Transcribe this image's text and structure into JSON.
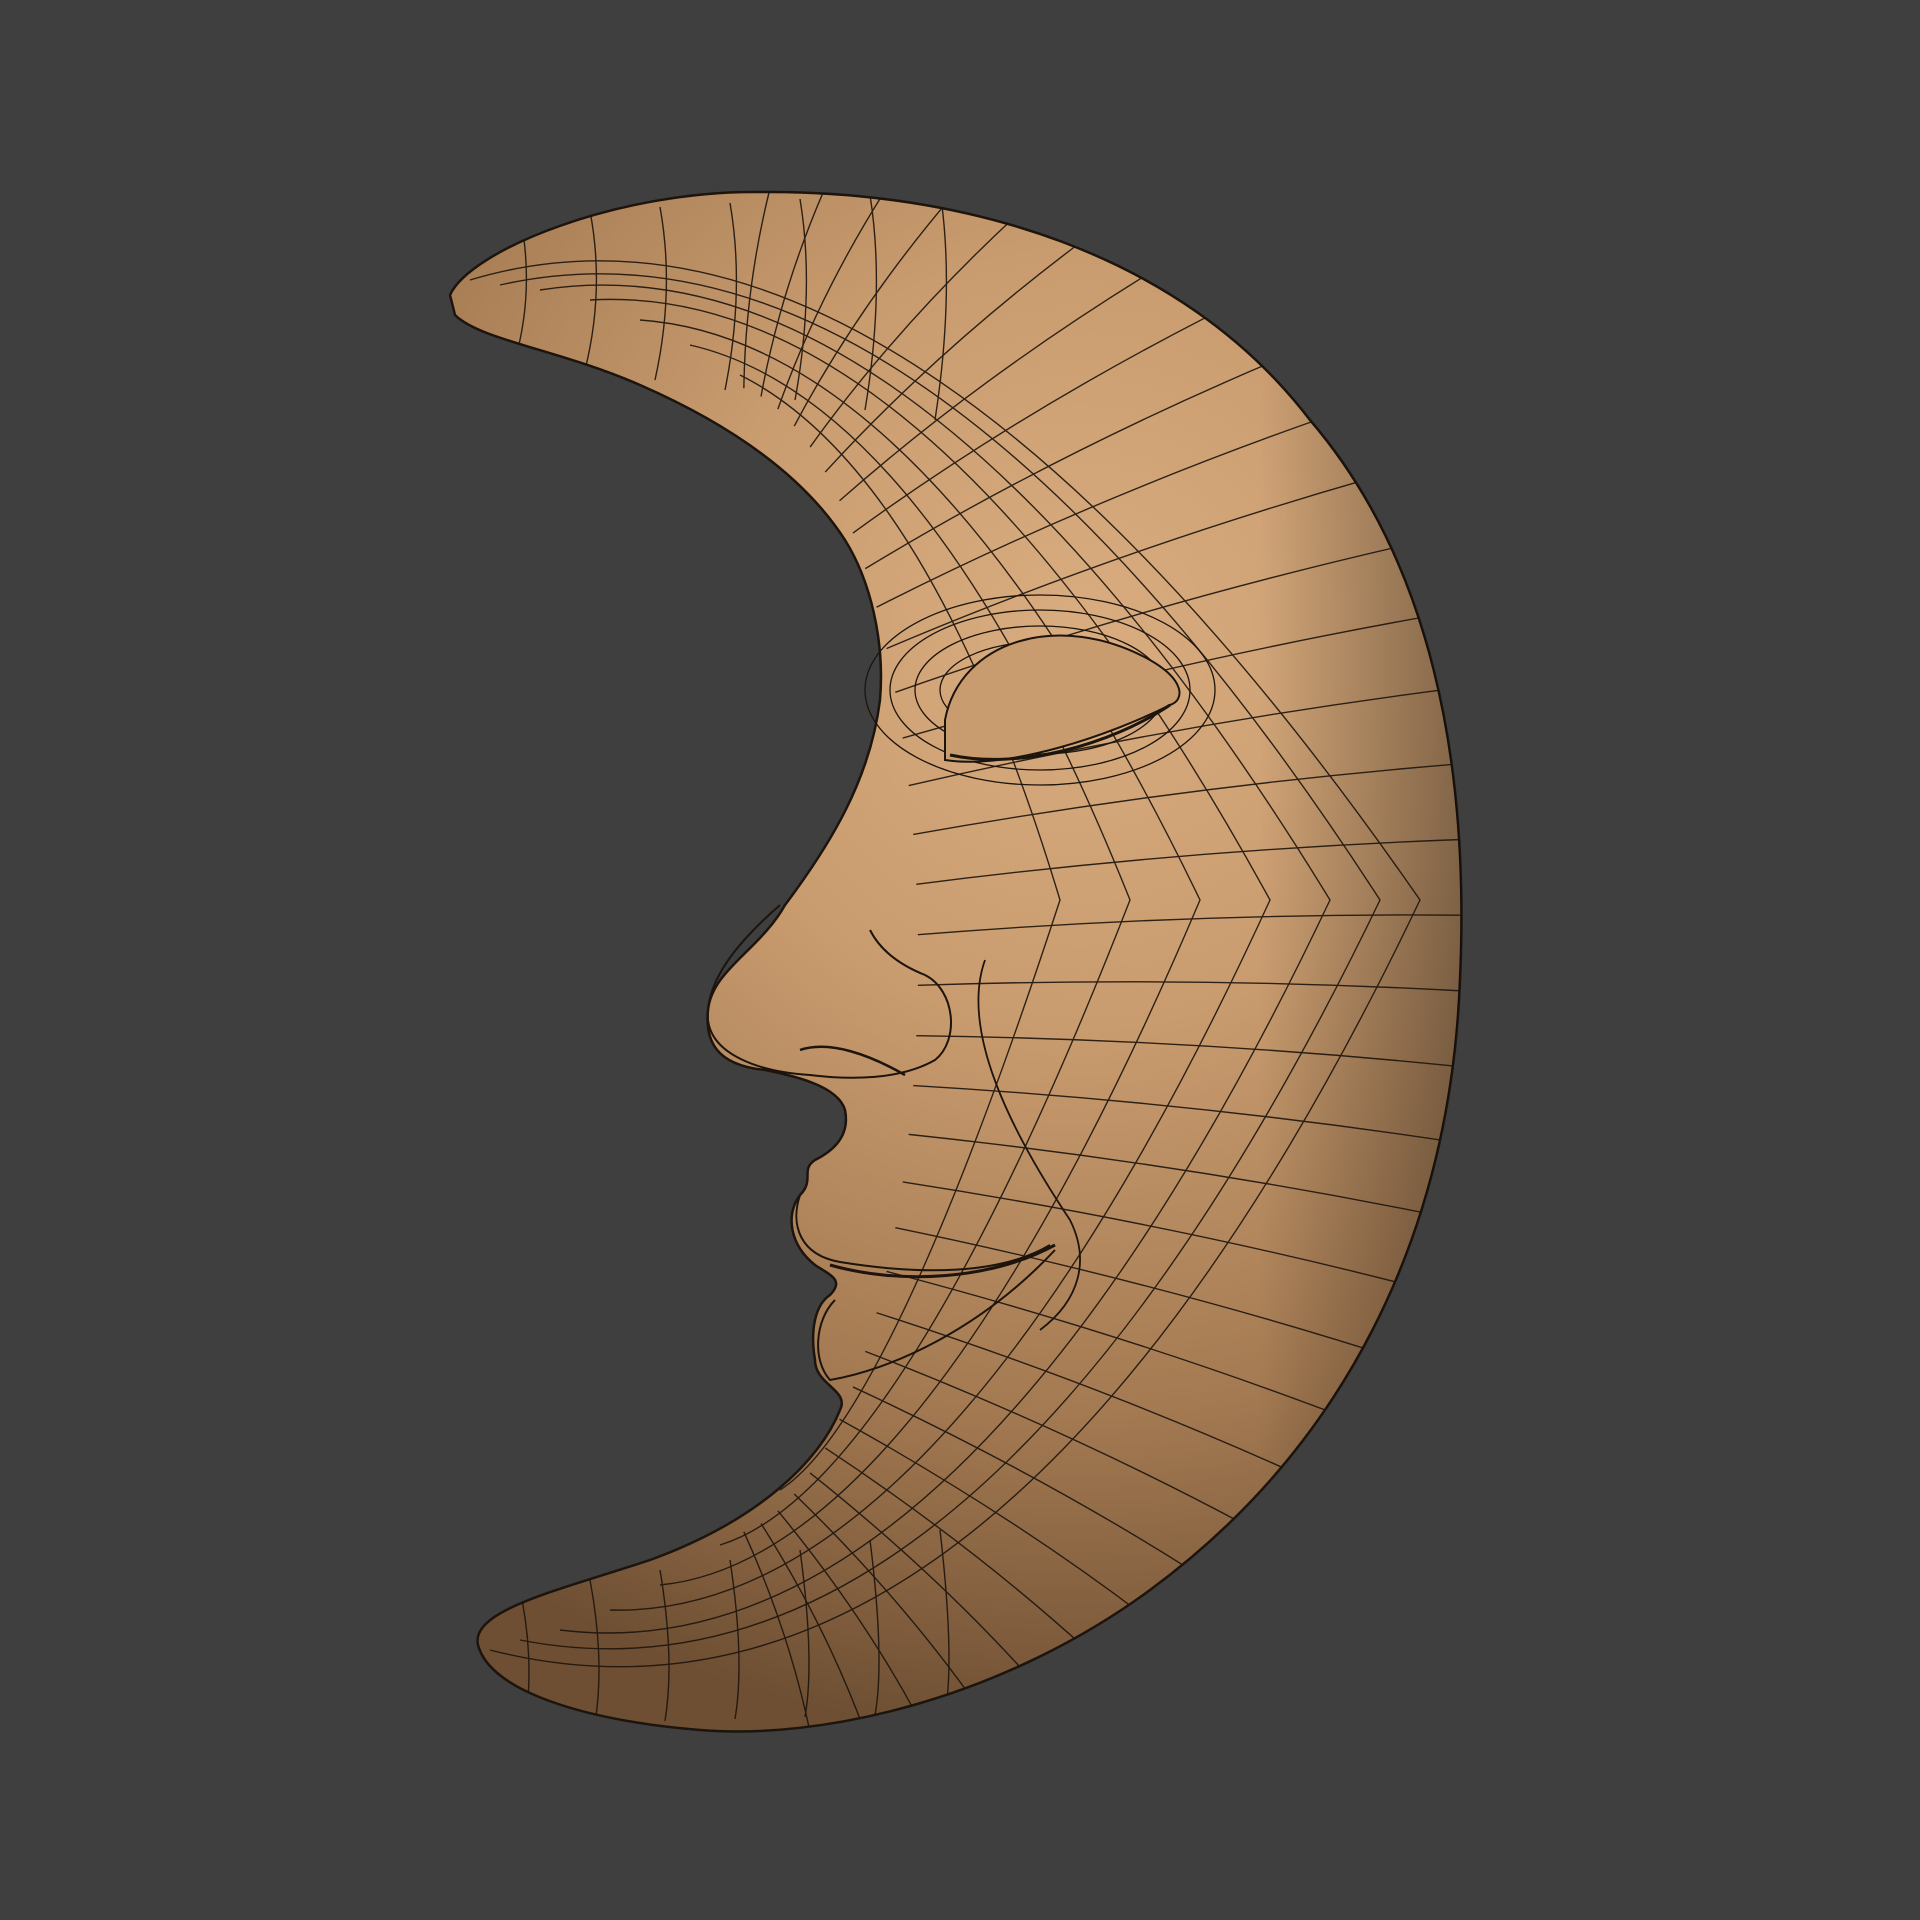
{
  "scene": {
    "subject": "crescent-moon-face-sculpt",
    "display_mode": "shaded-with-wireframe",
    "colors": {
      "background": "#3f3f3f",
      "surface_light": "#d3a679",
      "surface_mid": "#b88a5e",
      "surface_dark": "#7d5a3a",
      "wire": "#1c140d"
    }
  }
}
